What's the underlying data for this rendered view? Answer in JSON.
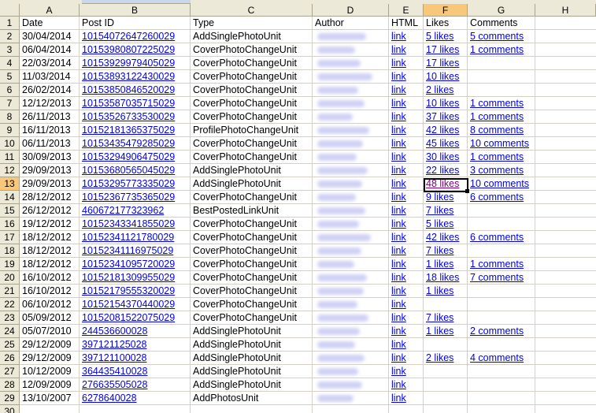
{
  "columns": [
    "A",
    "B",
    "C",
    "D",
    "E",
    "F",
    "G",
    "H"
  ],
  "selected_column": "F",
  "selected_row": 13,
  "header_row": {
    "row": 1,
    "date": "Date",
    "post_id": "Post ID",
    "type": "Type",
    "author": "Author",
    "html": "HTML",
    "likes": "Likes",
    "comments": "Comments"
  },
  "rows": [
    {
      "row": 2,
      "date": "30/04/2014",
      "post_id": "10154072647260029",
      "type": "AddSinglePhotoUnit",
      "html": "link",
      "likes": "5 likes",
      "comments": "5 comments"
    },
    {
      "row": 3,
      "date": "06/04/2014",
      "post_id": "10153980807225029",
      "type": "CoverPhotoChangeUnit",
      "html": "link",
      "likes": "17 likes",
      "comments": "1 comments"
    },
    {
      "row": 4,
      "date": "22/03/2014",
      "post_id": "10153929979405029",
      "type": "CoverPhotoChangeUnit",
      "html": "link",
      "likes": "17 likes",
      "comments": ""
    },
    {
      "row": 5,
      "date": "11/03/2014",
      "post_id": "10153893122430029",
      "type": "CoverPhotoChangeUnit",
      "html": "link",
      "likes": "10 likes",
      "comments": ""
    },
    {
      "row": 6,
      "date": "26/02/2014",
      "post_id": "10153850846520029",
      "type": "CoverPhotoChangeUnit",
      "html": "link",
      "likes": "2 likes",
      "comments": ""
    },
    {
      "row": 7,
      "date": "12/12/2013",
      "post_id": "10153587035715029",
      "type": "CoverPhotoChangeUnit",
      "html": "link",
      "likes": "10 likes",
      "comments": "1 comments"
    },
    {
      "row": 8,
      "date": "26/11/2013",
      "post_id": "10153526733530029",
      "type": "CoverPhotoChangeUnit",
      "html": "link",
      "likes": "37 likes",
      "comments": "1 comments"
    },
    {
      "row": 9,
      "date": "16/11/2013",
      "post_id": "10152181365375029",
      "type": "ProfilePhotoChangeUnit",
      "html": "link",
      "likes": "42 likes",
      "comments": "8 comments"
    },
    {
      "row": 10,
      "date": "06/11/2013",
      "post_id": "10153435479285029",
      "type": "CoverPhotoChangeUnit",
      "html": "link",
      "likes": "45 likes",
      "comments": "10 comments"
    },
    {
      "row": 11,
      "date": "30/09/2013",
      "post_id": "10153294906475029",
      "type": "CoverPhotoChangeUnit",
      "html": "link",
      "likes": "30 likes",
      "comments": "1 comments"
    },
    {
      "row": 12,
      "date": "29/09/2013",
      "post_id": "10153680565045029",
      "type": "AddSinglePhotoUnit",
      "html": "link",
      "likes": "22 likes",
      "comments": "3 comments"
    },
    {
      "row": 13,
      "date": "29/09/2013",
      "post_id": "10153295773335029",
      "type": "AddSinglePhotoUnit",
      "html": "link",
      "likes": "48 likes",
      "comments": "10 comments"
    },
    {
      "row": 14,
      "date": "28/12/2012",
      "post_id": "10152367735365029",
      "type": "CoverPhotoChangeUnit",
      "html": "link",
      "likes": "9 likes",
      "comments": "6 comments"
    },
    {
      "row": 15,
      "date": "26/12/2012",
      "post_id": "460672177323962",
      "type": "BestPostedLinkUnit",
      "html": "link",
      "likes": "7 likes",
      "comments": ""
    },
    {
      "row": 16,
      "date": "19/12/2012",
      "post_id": "10152343341855029",
      "type": "CoverPhotoChangeUnit",
      "html": "link",
      "likes": "5 likes",
      "comments": ""
    },
    {
      "row": 17,
      "date": "18/12/2012",
      "post_id": "10152341121780029",
      "type": "CoverPhotoChangeUnit",
      "html": "link",
      "likes": "42 likes",
      "comments": "6 comments"
    },
    {
      "row": 18,
      "date": "18/12/2012",
      "post_id": "10152341116975029",
      "type": "CoverPhotoChangeUnit",
      "html": "link",
      "likes": "7 likes",
      "comments": ""
    },
    {
      "row": 19,
      "date": "18/12/2012",
      "post_id": "10152341095720029",
      "type": "CoverPhotoChangeUnit",
      "html": "link",
      "likes": "1 likes",
      "comments": "1 comments"
    },
    {
      "row": 20,
      "date": "16/10/2012",
      "post_id": "10152181309955029",
      "type": "CoverPhotoChangeUnit",
      "html": "link",
      "likes": "18 likes",
      "comments": "7 comments"
    },
    {
      "row": 21,
      "date": "16/10/2012",
      "post_id": "10152179555320029",
      "type": "CoverPhotoChangeUnit",
      "html": "link",
      "likes": "1 likes",
      "comments": ""
    },
    {
      "row": 22,
      "date": "06/10/2012",
      "post_id": "10152154370440029",
      "type": "CoverPhotoChangeUnit",
      "html": "link",
      "likes": "",
      "comments": ""
    },
    {
      "row": 23,
      "date": "05/09/2012",
      "post_id": "10152081522075029",
      "type": "CoverPhotoChangeUnit",
      "html": "link",
      "likes": "7 likes",
      "comments": ""
    },
    {
      "row": 24,
      "date": "05/07/2010",
      "post_id": "244536600028",
      "type": "AddSinglePhotoUnit",
      "html": "link",
      "likes": "1 likes",
      "comments": "2 comments"
    },
    {
      "row": 25,
      "date": "29/12/2009",
      "post_id": "397121125028",
      "type": "AddSinglePhotoUnit",
      "html": "link",
      "likes": "",
      "comments": ""
    },
    {
      "row": 26,
      "date": "29/12/2009",
      "post_id": "397121100028",
      "type": "AddSinglePhotoUnit",
      "html": "link",
      "likes": "2 likes",
      "comments": "4 comments"
    },
    {
      "row": 27,
      "date": "10/12/2009",
      "post_id": "364435410028",
      "type": "AddSinglePhotoUnit",
      "html": "link",
      "likes": "",
      "comments": ""
    },
    {
      "row": 28,
      "date": "12/09/2009",
      "post_id": "276635505028",
      "type": "AddSinglePhotoUnit",
      "html": "link",
      "likes": "",
      "comments": ""
    },
    {
      "row": 29,
      "date": "13/10/2007",
      "post_id": "6278640028",
      "type": "AddPhotosUnit",
      "html": "link",
      "likes": "",
      "comments": ""
    }
  ],
  "trailing_rows": [
    "30"
  ],
  "colors": {
    "header_bg": "#ece9d8",
    "header_selected_bg": "#f9c77a",
    "grid": "#d4d0c8",
    "link": "#0000ee",
    "visited_link": "#800080",
    "author_redaction": "#c7c9f3"
  }
}
